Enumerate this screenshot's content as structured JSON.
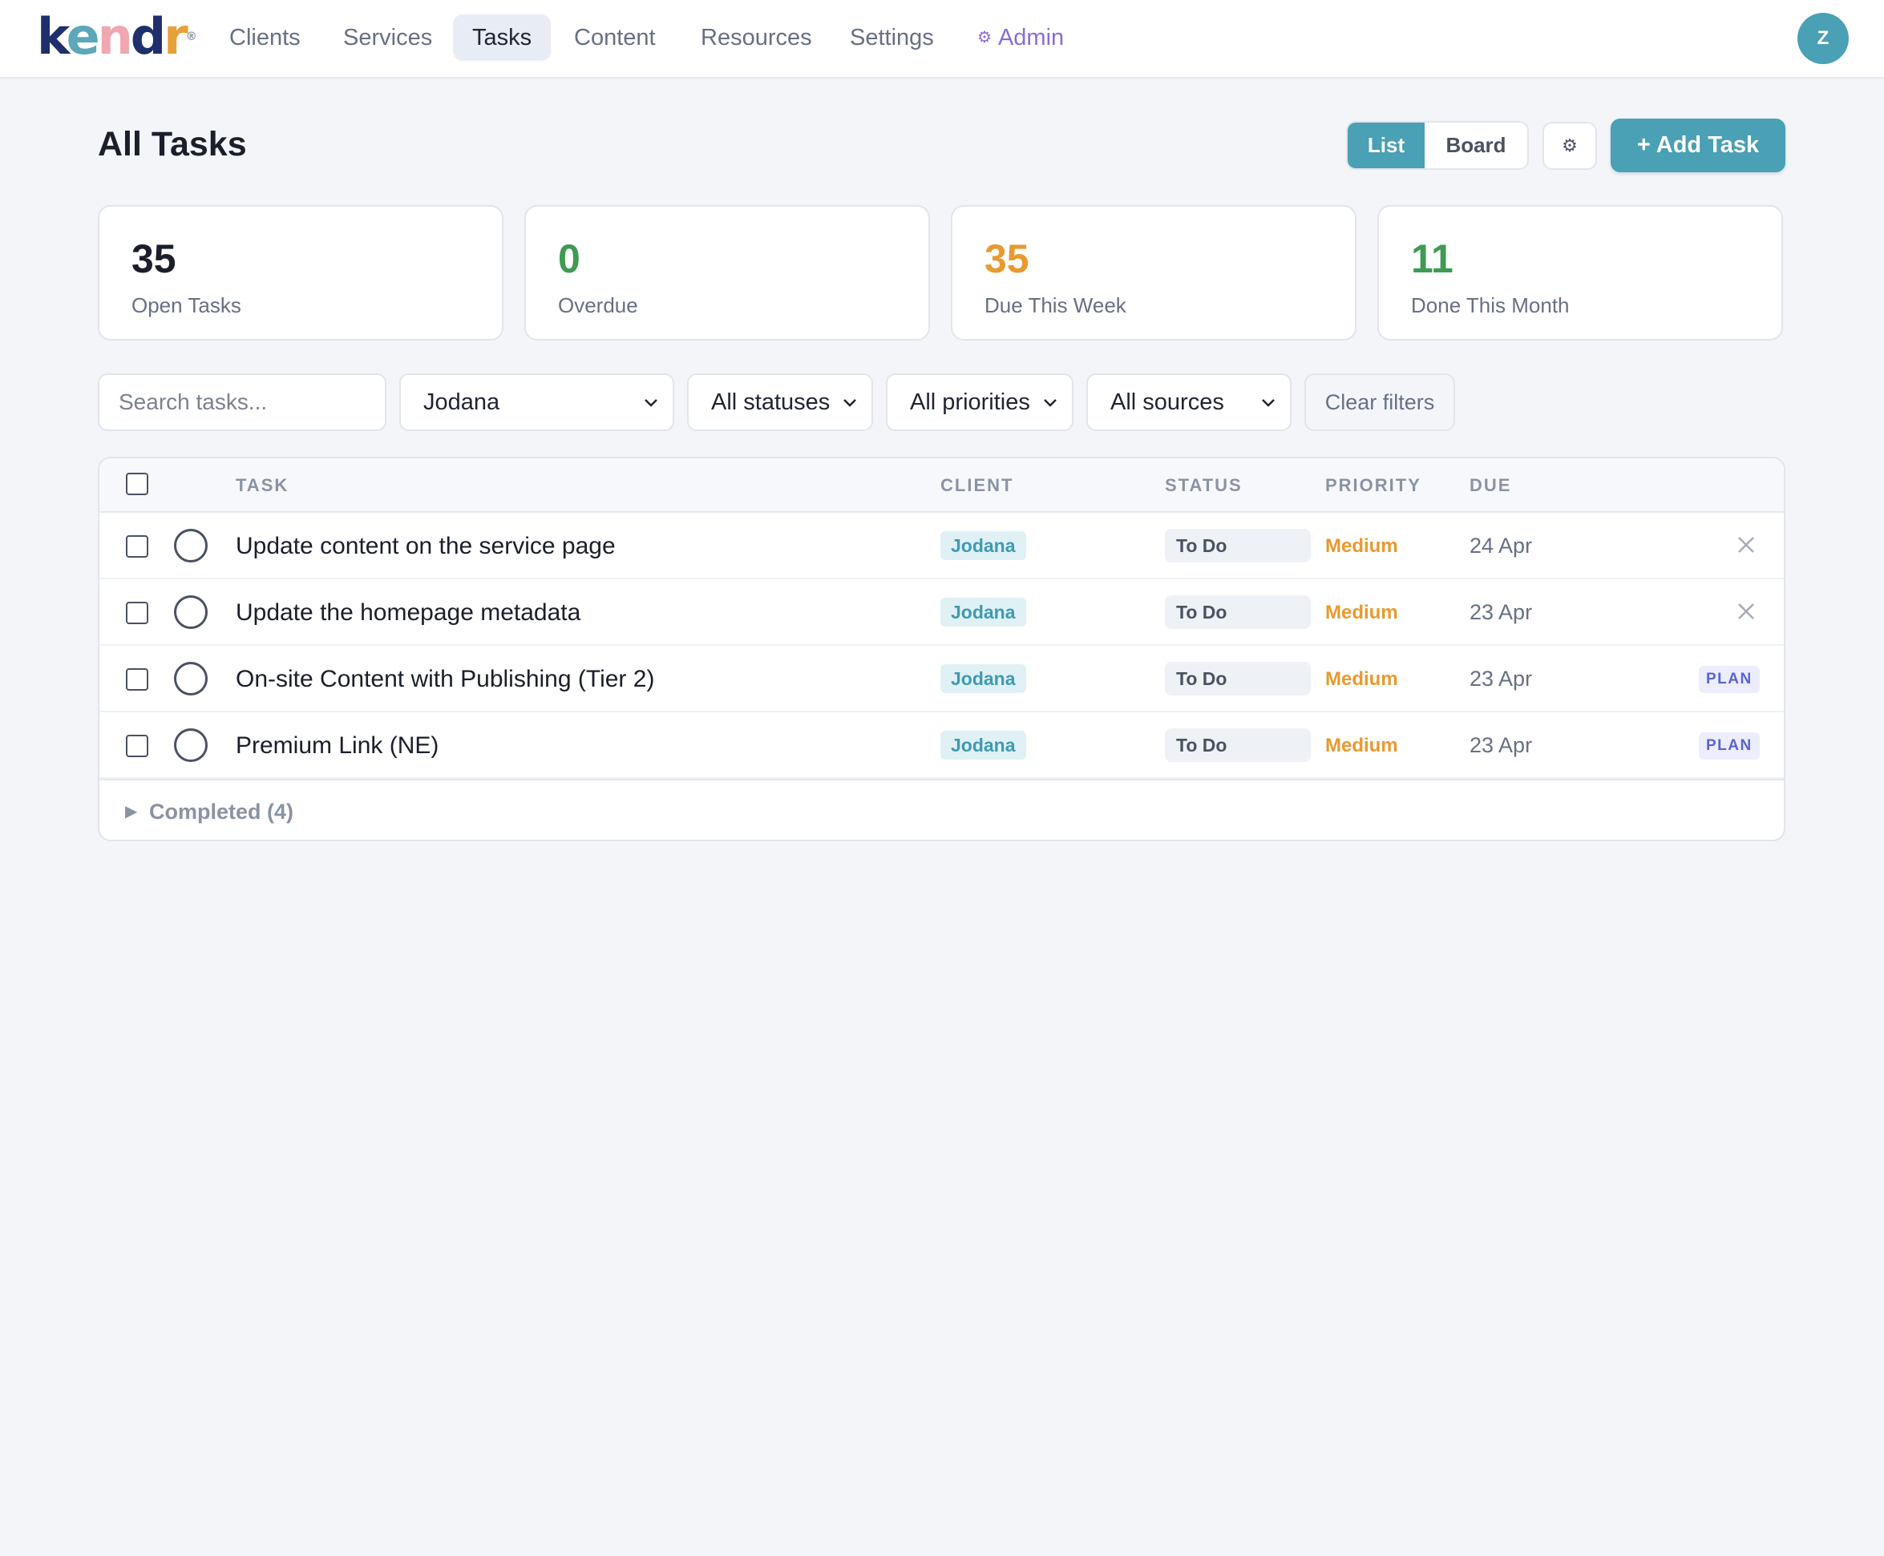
{
  "brand": {
    "logo_letters": [
      "k",
      "e",
      "n",
      "d",
      "r"
    ],
    "colors": [
      "#1e2f6b",
      "#5aa8b8",
      "#f0a7b0",
      "#1e2f6b",
      "#e8a038"
    ]
  },
  "nav": {
    "items": [
      {
        "label": "Clients",
        "active": false
      },
      {
        "label": "Services",
        "active": false
      },
      {
        "label": "Tasks",
        "active": true
      },
      {
        "label": "Content",
        "active": false
      },
      {
        "label": "Resources",
        "active": false
      },
      {
        "label": "Settings",
        "active": false
      }
    ],
    "admin_icon": "gear-icon",
    "admin_label": "Admin",
    "avatar_initial": "Z"
  },
  "header": {
    "title": "All Tasks",
    "view_options": [
      "List",
      "Board"
    ],
    "view_selected": "List",
    "settings_icon": "gear-icon",
    "add_label": "+ Add Task"
  },
  "stats": [
    {
      "value": "35",
      "label": "Open Tasks",
      "color": "#1a1f2b"
    },
    {
      "value": "0",
      "label": "Overdue",
      "color": "#3f9a52"
    },
    {
      "value": "35",
      "label": "Due This Week",
      "color": "#e89a2e"
    },
    {
      "value": "11",
      "label": "Done This Month",
      "color": "#3f9a52"
    }
  ],
  "filters": {
    "search_placeholder": "Search tasks...",
    "client": "Jodana",
    "status": "All statuses",
    "priority": "All priorities",
    "source": "All sources",
    "clear_label": "Clear filters"
  },
  "table": {
    "columns": {
      "task": "TASK",
      "client": "CLIENT",
      "status": "STATUS",
      "priority": "PRIORITY",
      "due": "DUE"
    },
    "rows": [
      {
        "title": "Update content on the service page",
        "client": "Jodana",
        "status": "To Do",
        "priority": "Medium",
        "due": "24 Apr",
        "action": "delete"
      },
      {
        "title": "Update the homepage metadata",
        "client": "Jodana",
        "status": "To Do",
        "priority": "Medium",
        "due": "23 Apr",
        "action": "delete"
      },
      {
        "title": "On-site Content with Publishing (Tier 2)",
        "client": "Jodana",
        "status": "To Do",
        "priority": "Medium",
        "due": "23 Apr",
        "action": "PLAN"
      },
      {
        "title": "Premium Link (NE)",
        "client": "Jodana",
        "status": "To Do",
        "priority": "Medium",
        "due": "23 Apr",
        "action": "PLAN"
      }
    ],
    "completed_label": "Completed (4)"
  },
  "accent_color": "#4aa0b4",
  "priority_color": "#e89a2e",
  "plan_color": "#5a62d8"
}
